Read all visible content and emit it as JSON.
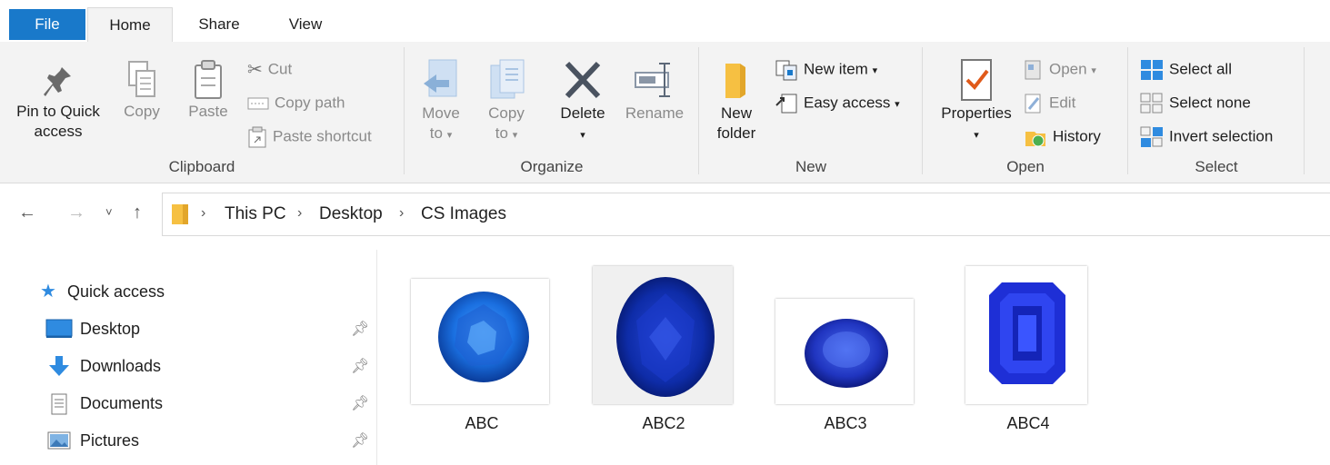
{
  "tabs": {
    "file": "File",
    "home": "Home",
    "share": "Share",
    "view": "View"
  },
  "clipboard": {
    "pin": "Pin to Quick access",
    "pin_l1": "Pin to Quick",
    "pin_l2": "access",
    "copy": "Copy",
    "paste": "Paste",
    "cut": "Cut",
    "copy_path": "Copy path",
    "paste_shortcut": "Paste shortcut",
    "group": "Clipboard"
  },
  "organize": {
    "move_to_l1": "Move",
    "move_to_l2": "to",
    "copy_to_l1": "Copy",
    "copy_to_l2": "to",
    "delete": "Delete",
    "rename": "Rename",
    "group": "Organize"
  },
  "new": {
    "new_folder_l1": "New",
    "new_folder_l2": "folder",
    "new_item": "New item",
    "easy_access": "Easy access",
    "group": "New"
  },
  "open": {
    "properties": "Properties",
    "open": "Open",
    "edit": "Edit",
    "history": "History",
    "group": "Open"
  },
  "select": {
    "select_all": "Select all",
    "select_none": "Select none",
    "invert": "Invert selection",
    "group": "Select"
  },
  "breadcrumb": {
    "items": [
      "This PC",
      "Desktop",
      "CS Images"
    ]
  },
  "nav": {
    "quick_access": "Quick access",
    "items": [
      "Desktop",
      "Downloads",
      "Documents",
      "Pictures"
    ]
  },
  "files": [
    {
      "name": "ABC",
      "shape": "round"
    },
    {
      "name": "ABC2",
      "shape": "oval"
    },
    {
      "name": "ABC3",
      "shape": "small-oval"
    },
    {
      "name": "ABC4",
      "shape": "emerald"
    }
  ],
  "colors": {
    "accent": "#1979ca",
    "gem_dark": "#0a1f8a",
    "gem_light": "#2f6fe0",
    "folder": "#f6c042"
  }
}
